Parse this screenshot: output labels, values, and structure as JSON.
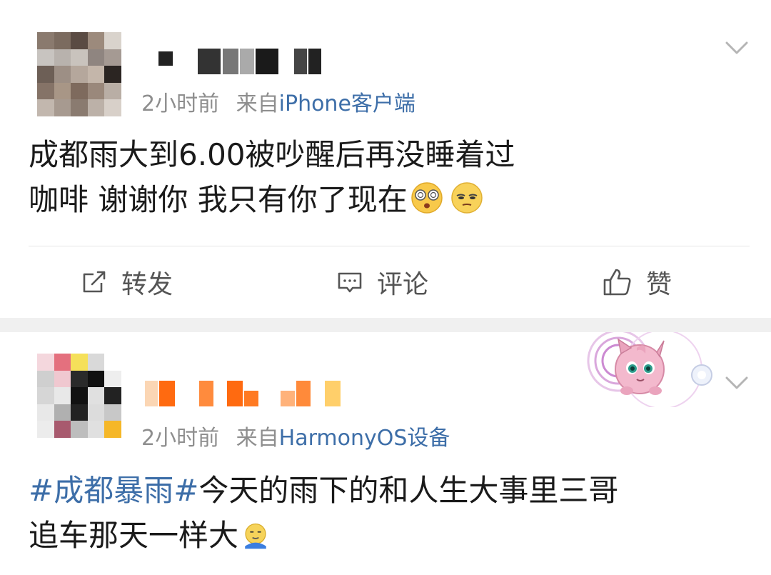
{
  "post1": {
    "time": "2小时前",
    "source_prefix": "来自",
    "source": "iPhone客户端",
    "text_line1": "成都雨大到6.00被吵醒后再没睡着过",
    "text_line2": "咖啡 谢谢你 我只有你了现在",
    "emojis": [
      "dizzy-eyes-emoji",
      "sleepy-face-emoji"
    ],
    "actions": {
      "repost": "转发",
      "comment": "评论",
      "like": "赞"
    }
  },
  "post2": {
    "time": "2小时前",
    "source_prefix": "来自",
    "source": "HarmonyOS设备",
    "hashtag": "#成都暴雨#",
    "text_line1_rest": "今天的雨下的和人生大事里三哥",
    "text_line2": "追车那天一样大",
    "emoji": "cold-face-emoji"
  },
  "colors": {
    "link": "#3d6ea8",
    "meta": "#8e8e8e",
    "separator": "#f0f0f0"
  }
}
